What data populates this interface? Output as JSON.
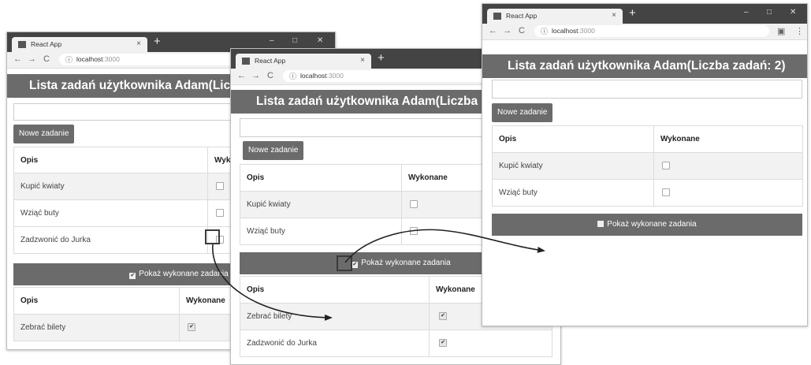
{
  "browser": {
    "tab_title": "React App",
    "tab_close": "×",
    "new_tab": "+",
    "minimize": "–",
    "maximize": "□",
    "close": "✕",
    "back": "←",
    "forward": "→",
    "reload": "C",
    "info": "ⓘ",
    "url_host": "localhost",
    "url_port": ":3000",
    "profile": "▣",
    "menu": "⋮"
  },
  "app": {
    "title_full": "Lista zadań użytkownika Adam(Liczba zadań: 2)",
    "title_cut_1": "Lista zadań użytkownika Adam(Lic",
    "title_cut_2": "Lista zadań użytkownika Adam(Liczba",
    "new_task_label": "Nowe zadanie",
    "show_done_label": "Pokaż wykonane zadania",
    "col_desc": "Opis",
    "col_done": "Wykonane",
    "col_done_cut": "Wyk",
    "tasks": [
      "Kupić kwiaty",
      "Wziąć buty",
      "Zadzwonić do Jurka"
    ],
    "done_tasks": [
      "Zebrać bilety",
      "Zadzwonić do Jurka"
    ],
    "checkmark": "✔"
  }
}
